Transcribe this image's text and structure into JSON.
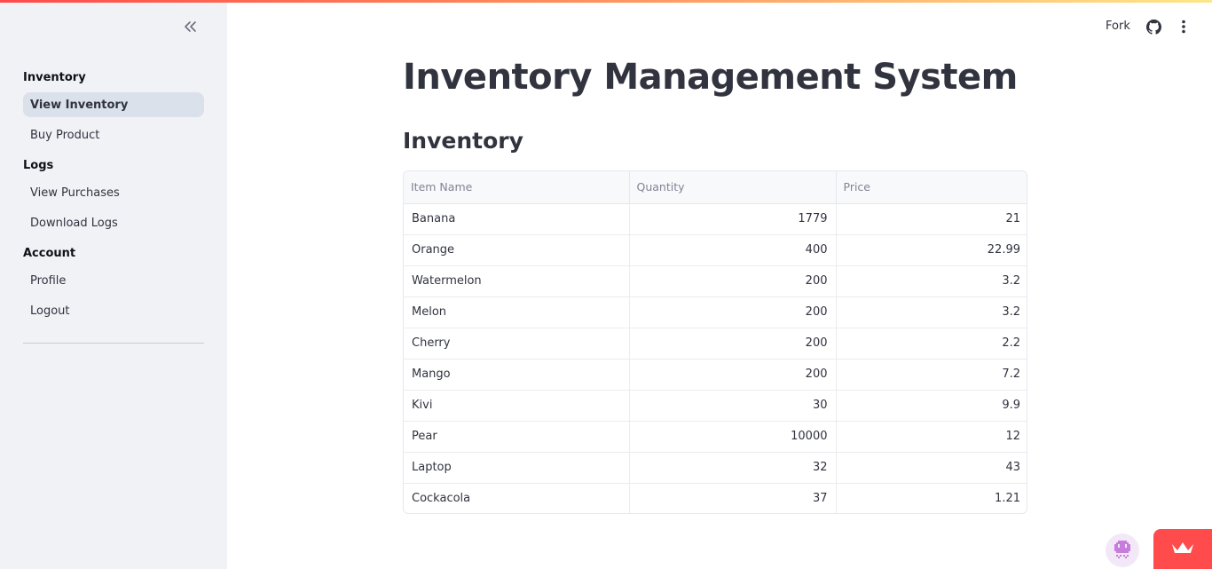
{
  "sidebar": {
    "sections": [
      {
        "title": "Inventory",
        "items": [
          "View Inventory",
          "Buy Product"
        ]
      },
      {
        "title": "Logs",
        "items": [
          "View Purchases",
          "Download Logs"
        ]
      },
      {
        "title": "Account",
        "items": [
          "Profile",
          "Logout"
        ]
      }
    ],
    "active_item": "View Inventory",
    "collapse_icon": "chevrons-left-icon"
  },
  "header": {
    "fork_label": "Fork",
    "github_icon": "github-icon",
    "menu_icon": "kebab-menu-icon"
  },
  "main": {
    "title": "Inventory Management System",
    "section_title": "Inventory",
    "table": {
      "columns": [
        "Item Name",
        "Quantity",
        "Price"
      ],
      "rows": [
        [
          "Banana",
          "1779",
          "21"
        ],
        [
          "Orange",
          "400",
          "22.99"
        ],
        [
          "Watermelon",
          "200",
          "3.2"
        ],
        [
          "Melon",
          "200",
          "3.2"
        ],
        [
          "Cherry",
          "200",
          "2.2"
        ],
        [
          "Mango",
          "200",
          "7.2"
        ],
        [
          "Kivi",
          "30",
          "9.9"
        ],
        [
          "Pear",
          "10000",
          "12"
        ],
        [
          "Laptop",
          "32",
          "43"
        ],
        [
          "Cockacola",
          "37",
          "1.21"
        ]
      ]
    }
  },
  "colors": {
    "accent": "#ff4b4b",
    "sidebar_bg": "#f0f2f6",
    "active_item_bg": "#dbe1ea",
    "text": "#31333f"
  }
}
